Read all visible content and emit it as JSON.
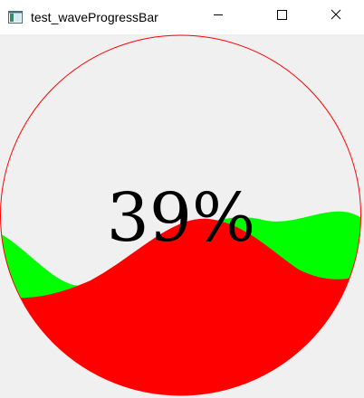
{
  "window": {
    "title": "test_waveProgressBar"
  },
  "progress": {
    "value": 0.39,
    "label": "39%"
  },
  "colors": {
    "ring": "#ff0000",
    "front_wave": "#ff0000",
    "back_wave": "#00ff00",
    "text": "#000000",
    "background": "#f0f0f0"
  },
  "icons": {
    "app": "app-window-icon",
    "minimize": "minimize-icon",
    "maximize": "maximize-icon",
    "close": "close-icon"
  }
}
